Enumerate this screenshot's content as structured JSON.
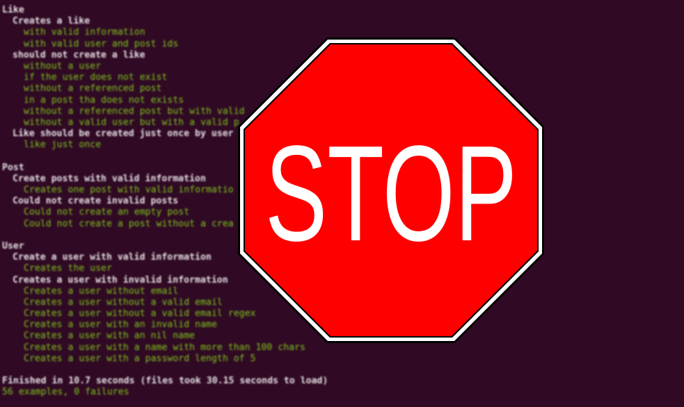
{
  "terminal": {
    "lines": [
      {
        "kind": "group",
        "text": "Like"
      },
      {
        "kind": "ctx",
        "text": "Creates a like"
      },
      {
        "kind": "ok",
        "text": "with valid information"
      },
      {
        "kind": "ok",
        "text": "with valid user and post ids"
      },
      {
        "kind": "ctx",
        "text": "should not create a like"
      },
      {
        "kind": "ok",
        "text": "without a user"
      },
      {
        "kind": "ok",
        "text": "if the user does not exist"
      },
      {
        "kind": "ok",
        "text": "without a referenced post"
      },
      {
        "kind": "ok",
        "text": "in a post tha does not exists"
      },
      {
        "kind": "ok",
        "text": "without a referenced post but with valid"
      },
      {
        "kind": "ok",
        "text": "without a valid user but with a valid p"
      },
      {
        "kind": "ctx",
        "text": "Like should be created just once by user"
      },
      {
        "kind": "ok",
        "text": "like just once"
      },
      {
        "kind": "gap",
        "text": ""
      },
      {
        "kind": "group",
        "text": "Post"
      },
      {
        "kind": "ctx",
        "text": "Create posts with valid information"
      },
      {
        "kind": "ok",
        "text": "Creates one post with valid informatio"
      },
      {
        "kind": "ctx",
        "text": "Could not create invalid posts"
      },
      {
        "kind": "ok",
        "text": "Could not create an empty post"
      },
      {
        "kind": "ok",
        "text": "Could not create a post without a crea"
      },
      {
        "kind": "gap",
        "text": ""
      },
      {
        "kind": "group",
        "text": "User"
      },
      {
        "kind": "ctx",
        "text": "Create a user with valid information"
      },
      {
        "kind": "ok",
        "text": "Creates the user"
      },
      {
        "kind": "ctx",
        "text": "Creates a user with invalid information"
      },
      {
        "kind": "ok",
        "text": "Creates a user without email"
      },
      {
        "kind": "ok",
        "text": "Creates a user without a valid email"
      },
      {
        "kind": "ok",
        "text": "Creates a user without a valid email regex"
      },
      {
        "kind": "ok",
        "text": "Creates a user with an invalid name"
      },
      {
        "kind": "ok",
        "text": "Creates a user with an nil name"
      },
      {
        "kind": "ok",
        "text": "Creates a user with a name with more than 100 chars"
      },
      {
        "kind": "ok",
        "text": "Creates a user with a password length of 5"
      },
      {
        "kind": "gap",
        "text": ""
      },
      {
        "kind": "summary",
        "text": "Finished in 10.7 seconds (files took 30.15 seconds to load)"
      },
      {
        "kind": "summary-green",
        "text": "56 examples, 0 failures"
      }
    ]
  },
  "stop_sign": {
    "label": "STOP",
    "fill_color": "#ff0000",
    "border_color": "#ffffff",
    "outline_color": "#000000",
    "text_color": "#ffffff"
  }
}
